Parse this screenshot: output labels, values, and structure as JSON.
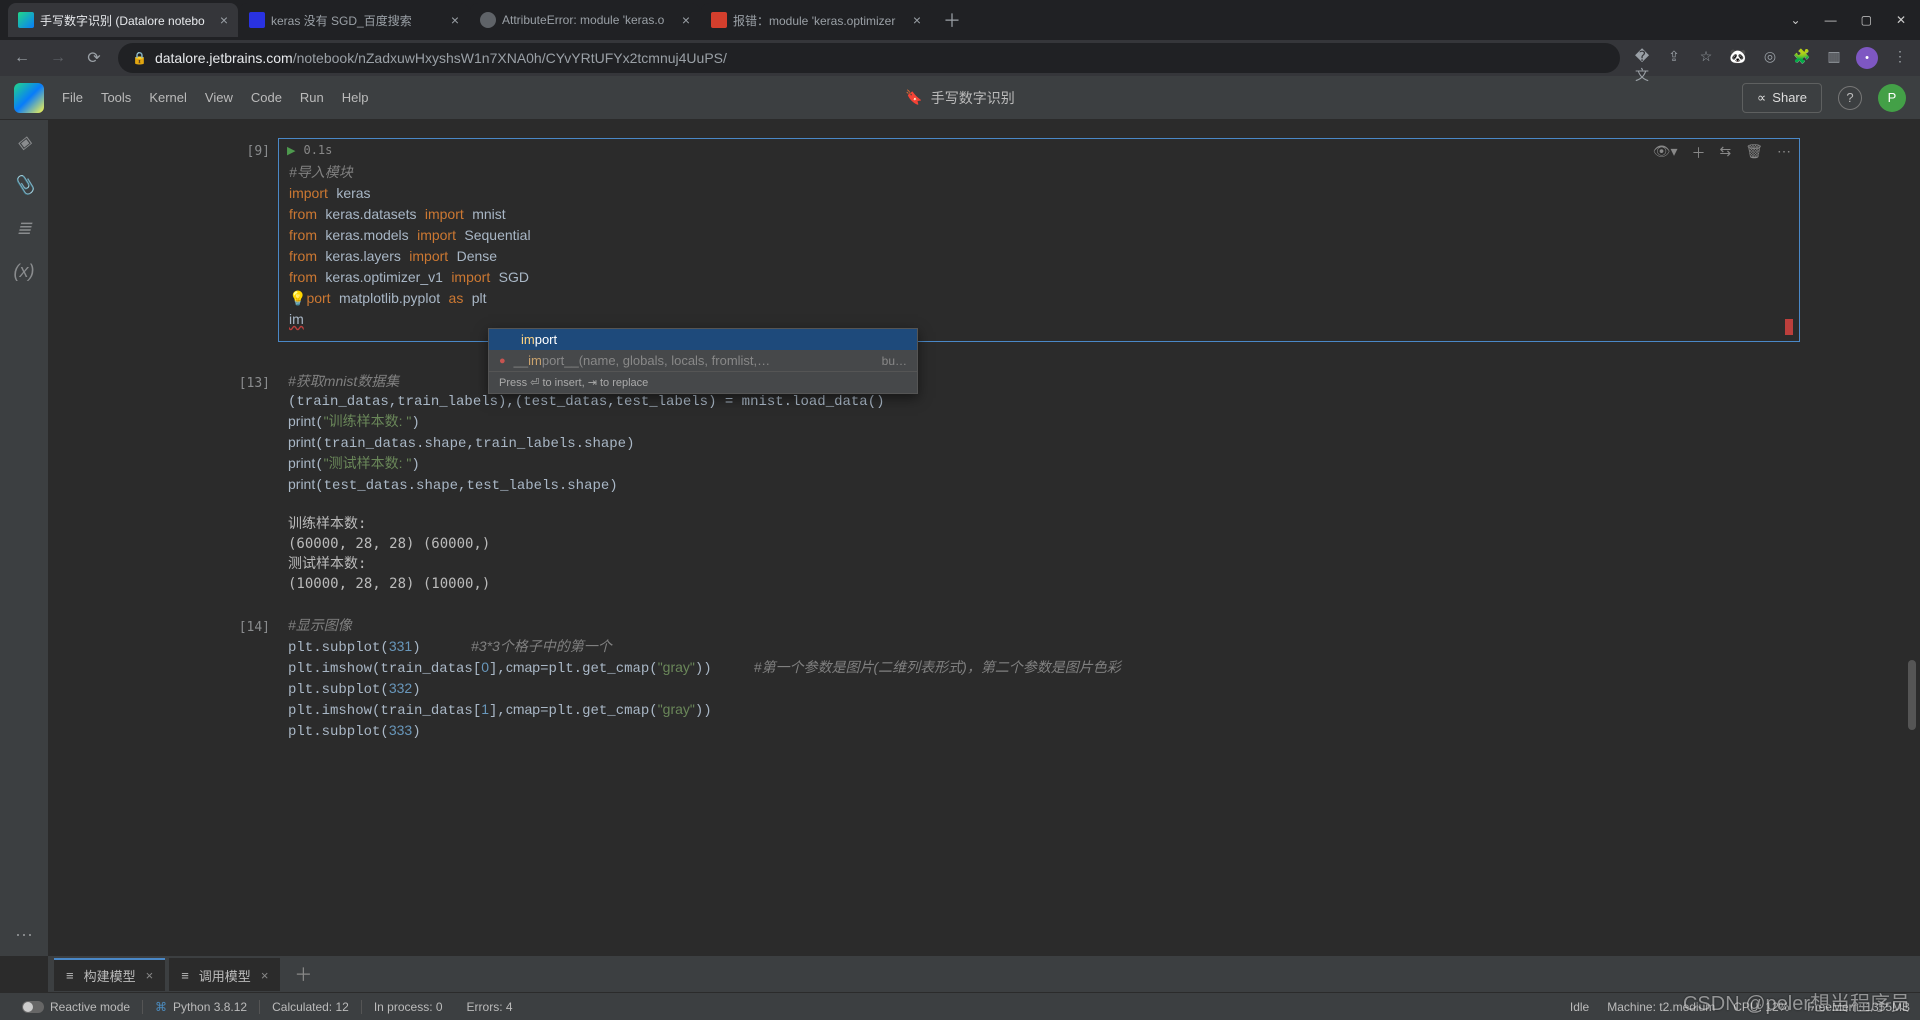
{
  "chrome": {
    "tabs": [
      {
        "title": "手写数字识别 (Datalore notebo",
        "active": true,
        "favicon": "#21d789"
      },
      {
        "title": "keras 没有 SGD_百度搜索",
        "active": false,
        "favicon": "#2932e1"
      },
      {
        "title": "AttributeError: module 'keras.o",
        "active": false,
        "favicon": "#5f6368"
      },
      {
        "title": "报错：module 'keras.optimizer",
        "active": false,
        "favicon": "#d43f2d"
      }
    ],
    "url_host": "datalore.jetbrains.com",
    "url_path": "/notebook/nZadxuwHxyshsW1n7XNA0h/CYvYRtUFYx2tcmnuj4UuPS/",
    "win_controls": [
      "—",
      "▢",
      "✕"
    ],
    "addr_icons": [
      "←",
      "→",
      "⟳"
    ]
  },
  "header": {
    "menus": [
      "File",
      "Tools",
      "Kernel",
      "View",
      "Code",
      "Run",
      "Help"
    ],
    "notebook_title": "手写数字识别",
    "share_label": "Share",
    "avatar_letter": "P"
  },
  "rail": {
    "items": [
      "cube",
      "clip",
      "toc",
      "var"
    ],
    "labels": [
      "◈",
      "📎",
      "≣",
      "(x)"
    ]
  },
  "cells": {
    "c9": {
      "prompt": "[9]",
      "exec_time": "0.1s",
      "line_comment": "#导入模块",
      "partial": "im",
      "tools": [
        "👁▾",
        "＋",
        "⇆",
        "🗑",
        "⋯"
      ]
    },
    "c13": {
      "prompt": "[13]",
      "comment": "#获取mnist数据集",
      "str1": "\"训练样本数: \"",
      "str2": "\"测试样本数: \"",
      "output": "训练样本数:\n(60000, 28, 28) (60000,)\n测试样本数:\n(10000, 28, 28) (10000,)"
    },
    "c14": {
      "prompt": "[14]",
      "comment": "#显示图像",
      "cmt1": "#3*3个格子中的第一个",
      "cmt2": "#第一个参数是图片(二维列表形式)，第二个参数是图片色彩"
    }
  },
  "autocomplete": {
    "item1": "import",
    "item1_match": "im",
    "item2_prefix": "__",
    "item2_match": "im",
    "item2_rest": "port__(name, globals, locals, fromlist,…",
    "item2_tail": "bu…",
    "hint": "Press ⏎ to insert, ⇥ to replace"
  },
  "sheets": {
    "s1": "构建模型",
    "s2": "调用模型"
  },
  "status": {
    "reactive": "Reactive mode",
    "python": "Python 3.8.12",
    "calc": "Calculated: 12",
    "inproc": "In process: 0",
    "errors": "Errors: 4",
    "idle": "Idle",
    "machine": "Machine: t2.medium",
    "cpu": "CPU: 12%",
    "mem": "FreeMem: 1355MB"
  },
  "watermark": "CSDN @peler想当程序员"
}
